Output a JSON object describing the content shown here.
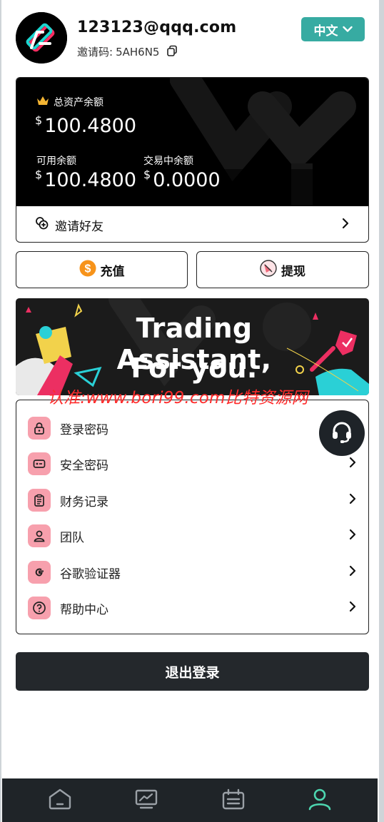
{
  "header": {
    "email": "123123@qqq.com",
    "invite_code_label": "邀请码:",
    "invite_code": "5AH6N5",
    "language": "中文"
  },
  "assets": {
    "total_label": "总资产余额",
    "currency_symbol": "$",
    "total_value": "100.4800",
    "available_label": "可用余额",
    "available_value": "100.4800",
    "in_trade_label": "交易中余额",
    "in_trade_value": "0.0000",
    "invite_friends_label": "邀请好友"
  },
  "actions": {
    "recharge_label": "充值",
    "withdraw_label": "提现"
  },
  "banner": {
    "line1": "Trading Assistant,",
    "line2": "For you.",
    "watermark": "认准:www.bori99.com比特资源网"
  },
  "menu": {
    "items": [
      {
        "label": "登录密码",
        "icon": "lock-icon"
      },
      {
        "label": "安全密码",
        "icon": "password-field-icon"
      },
      {
        "label": "财务记录",
        "icon": "clipboard-icon"
      },
      {
        "label": "团队",
        "icon": "user-icon"
      },
      {
        "label": "谷歌验证器",
        "icon": "google-icon"
      },
      {
        "label": "帮助中心",
        "icon": "question-icon"
      }
    ]
  },
  "logout_label": "退出登录",
  "bottom_nav": {
    "items": [
      "home-icon",
      "chart-icon",
      "orders-icon",
      "profile-icon"
    ],
    "active_index": 3
  },
  "colors": {
    "accent_teal": "#37aba2",
    "menu_icon_bg": "#f7a0ad",
    "nav_active": "#4dd6b0",
    "dark": "#24282c"
  }
}
